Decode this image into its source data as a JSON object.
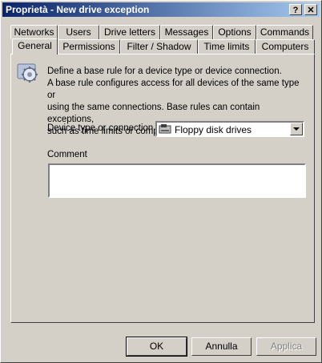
{
  "window": {
    "title": "Proprietà - New drive exception",
    "help_btn": "?",
    "close_btn": "✕"
  },
  "tabs_row1": [
    "Networks",
    "Users",
    "Drive letters",
    "Messages",
    "Options",
    "Commands"
  ],
  "tabs_row2": [
    "General",
    "Permissions",
    "Filter / Shadow",
    "Time limits",
    "Computers"
  ],
  "active_tab": "General",
  "general": {
    "description_lines": [
      "Define a base rule for a device type or device connection.",
      "A base rule configures access for all devices of the same type or",
      "using the same connections. Base rules can contain exceptions,",
      "such as time limits or computer constraints."
    ],
    "device_type_label": "Device type or connection",
    "device_type_value": "Floppy disk drives",
    "comment_label": "Comment",
    "comment_value": ""
  },
  "buttons": {
    "ok": "OK",
    "cancel": "Annulla",
    "apply": "Applica"
  }
}
